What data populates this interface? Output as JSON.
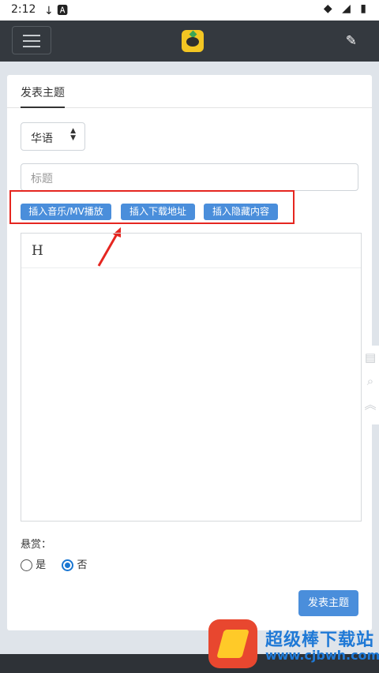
{
  "status_bar": {
    "time": "2:12",
    "left_icons": "↓ 🅰",
    "right_icons": "◆ ◢ ▮"
  },
  "navbar": {
    "menu_icon": "hamburger-icon",
    "logo_icon": "app-logo",
    "edit_icon": "edit-icon"
  },
  "tabs": {
    "active": "发表主题"
  },
  "form": {
    "language_select": {
      "value": "华语"
    },
    "title_input": {
      "placeholder": "标题",
      "value": ""
    },
    "insert_buttons": [
      "插入音乐/MV播放",
      "插入下载地址",
      "插入隐藏内容"
    ],
    "editor": {
      "heading_button": "H"
    },
    "reward": {
      "label": "悬赏：",
      "options": [
        {
          "label": "是",
          "checked": false
        },
        {
          "label": "否",
          "checked": true
        }
      ]
    },
    "submit_label": "发表主题"
  },
  "watermark": {
    "text": "超级棒下载站",
    "url": "www.cjbwh.com"
  },
  "colors": {
    "accent": "#4a8edb",
    "highlight": "#e52620",
    "navbar": "#34393f"
  }
}
